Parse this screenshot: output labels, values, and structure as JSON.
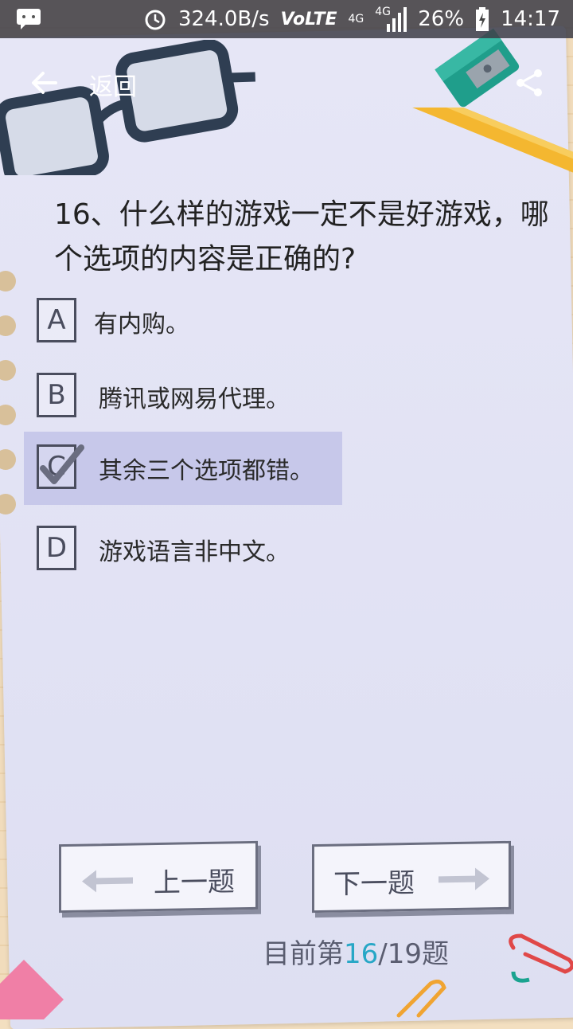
{
  "status_bar": {
    "speed": "324.0B/s",
    "network_label": "VoLTE",
    "signal_4g_1": "4G",
    "signal_4g_2": "4G",
    "battery": "26%",
    "time": "14:17"
  },
  "header": {
    "back_label": "返回"
  },
  "question": {
    "text": "16、什么样的游戏一定不是好游戏，哪个选项的内容是正确的?"
  },
  "options": [
    {
      "letter": "A",
      "text": "有内购。",
      "selected": false
    },
    {
      "letter": "B",
      "text": "腾讯或网易代理。",
      "selected": false
    },
    {
      "letter": "C",
      "text": "其余三个选项都错。",
      "selected": true
    },
    {
      "letter": "D",
      "text": "游戏语言非中文。",
      "selected": false
    }
  ],
  "navigation": {
    "prev_label": "上一题",
    "next_label": "下一题"
  },
  "progress": {
    "prefix": "目前第",
    "current": "16",
    "separator": "/",
    "total": "19",
    "suffix": "题"
  },
  "colors": {
    "accent": "#27a7c6",
    "selected_bg": "#c7c8ea",
    "paper": "#e4e4f5"
  }
}
